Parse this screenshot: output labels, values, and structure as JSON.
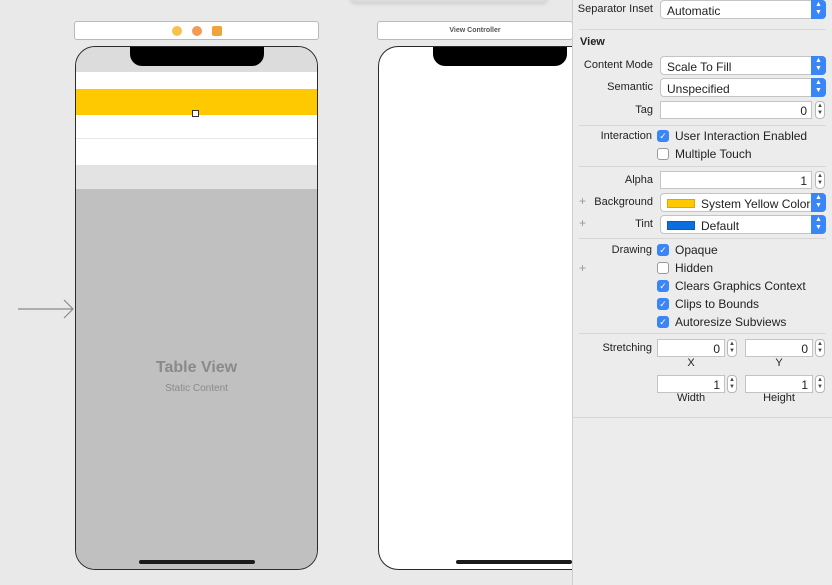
{
  "canvas": {
    "scene1": {
      "icon_colors": [
        "#f9b43e",
        "#f58a46",
        "#f2a23a"
      ]
    },
    "scene2": {
      "title": "View Controller"
    },
    "table_view": {
      "title": "Table View",
      "subtitle": "Static Content",
      "highlight_color": "#ffc900"
    }
  },
  "inspector": {
    "separator_inset": {
      "label": "Separator Inset",
      "value": "Automatic"
    },
    "section_title": "View",
    "content_mode": {
      "label": "Content Mode",
      "value": "Scale To Fill"
    },
    "semantic": {
      "label": "Semantic",
      "value": "Unspecified"
    },
    "tag": {
      "label": "Tag",
      "value": "0"
    },
    "interaction": {
      "label": "Interaction",
      "options": [
        {
          "text": "User Interaction Enabled",
          "checked": true
        },
        {
          "text": "Multiple Touch",
          "checked": false
        }
      ]
    },
    "alpha": {
      "label": "Alpha",
      "value": "1"
    },
    "background": {
      "label": "Background",
      "value": "System Yellow Color",
      "swatch": "#ffc900"
    },
    "tint": {
      "label": "Tint",
      "value": "Default",
      "swatch": "#0a6ede"
    },
    "drawing": {
      "label": "Drawing",
      "options": [
        {
          "text": "Opaque",
          "checked": true
        },
        {
          "text": "Hidden",
          "checked": false
        },
        {
          "text": "Clears Graphics Context",
          "checked": true
        },
        {
          "text": "Clips to Bounds",
          "checked": true
        },
        {
          "text": "Autoresize Subviews",
          "checked": true
        }
      ]
    },
    "stretching": {
      "label": "Stretching",
      "x": "0",
      "y": "0",
      "width": "1",
      "height": "1",
      "x_label": "X",
      "y_label": "Y",
      "width_label": "Width",
      "height_label": "Height"
    }
  }
}
